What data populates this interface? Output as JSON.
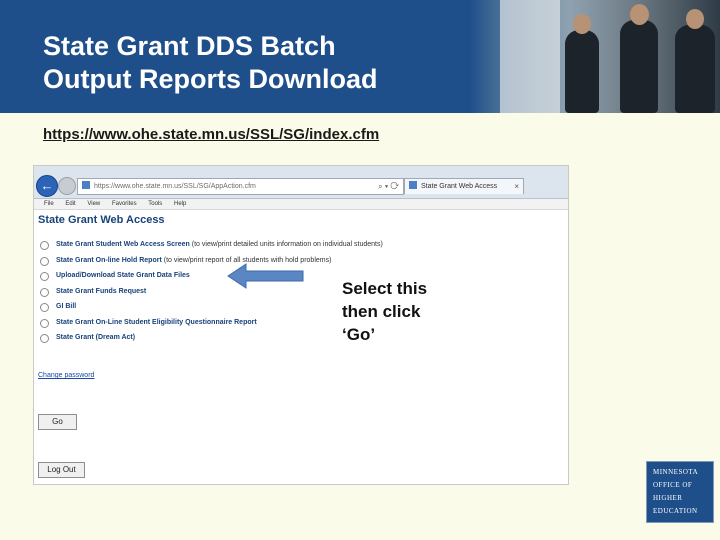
{
  "slide": {
    "title_line1": "State Grant DDS Batch",
    "title_line2": "Output Reports Download",
    "url": "https://www.ohe.state.mn.us/SSL/SG/index.cfm"
  },
  "browser": {
    "address": "https://www.ohe.state.mn.us/SSL/SG/AppAction.cfm",
    "address_icons": "⌕ ▾ ⟳",
    "tab_label": "State Grant Web Access",
    "tab_close": "×",
    "menu": [
      "File",
      "Edit",
      "View",
      "Favorites",
      "Tools",
      "Help"
    ]
  },
  "web": {
    "title": "State Grant Web Access",
    "options": [
      {
        "label": "State Grant Student Web Access Screen",
        "desc": " (to view/print detailed units information on individual students)"
      },
      {
        "label": "State Grant On-line Hold Report",
        "desc": " (to view/print report of all students with hold problems)"
      },
      {
        "label": "Upload/Download State Grant Data Files",
        "desc": ""
      },
      {
        "label": "State Grant Funds Request",
        "desc": ""
      },
      {
        "label": "GI Bill",
        "desc": ""
      },
      {
        "label": "State Grant On-Line Student Eligibility Questionnaire Report",
        "desc": ""
      },
      {
        "label": "State Grant (Dream Act)",
        "desc": ""
      }
    ],
    "change_password": "Change password",
    "go": "Go",
    "logout": "Log Out"
  },
  "callout": {
    "line1": "Select this",
    "line2": "then click",
    "line3": "‘Go’"
  },
  "logo": {
    "line1": "MINNESOTA",
    "line2": "OFFICE OF",
    "line3": "HIGHER",
    "line4": "EDUCATION"
  },
  "colors": {
    "header_blue": "#1f4f8a",
    "page_bg": "#fbfbe9",
    "web_title_blue": "#17427a",
    "arrow_blue": "#5b86c4"
  }
}
